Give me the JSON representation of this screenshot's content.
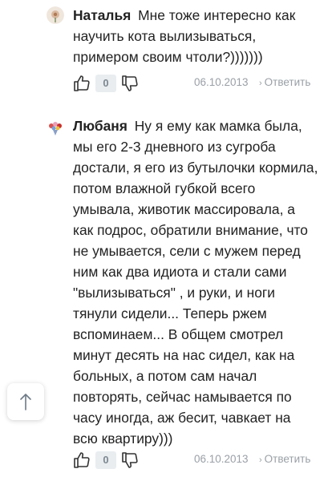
{
  "comments": [
    {
      "author": "Наталья",
      "text": "Мне тоже интересно как научить кота вылизываться, примером своим чтоли?)))))))",
      "likes": "0",
      "date": "06.10.2013",
      "reply_label": "Ответить",
      "avatar_icon": "flower-avatar-icon"
    },
    {
      "author": "Любаня",
      "text": "Ну я ему как мамка была, мы его 2-3 дневного из сугроба достали, я его из бутылочки кормила, потом влажной губкой всего умывала, животик массировала,  а как подрос, обратили внимание, что не умывается, сели с мужем перед ним как два идиота и стали сами \"вылизываться\" , и руки, и ноги тянули сидели... Теперь ржем вспоминаем... В общем смотрел минут десять на нас сидел, как на больных, а потом сам начал повторять,  сейчас намывается по часу иногда, аж бесит, чавкает на всю квартиру)))",
      "likes": "0",
      "date": "06.10.2013",
      "reply_label": "Ответить",
      "avatar_icon": "bouquet-avatar-icon"
    }
  ],
  "colors": {
    "text": "#222222",
    "muted": "#9aa0a6",
    "counter_bg": "#e9edf0"
  },
  "scroll_top_icon": "arrow-up-icon"
}
